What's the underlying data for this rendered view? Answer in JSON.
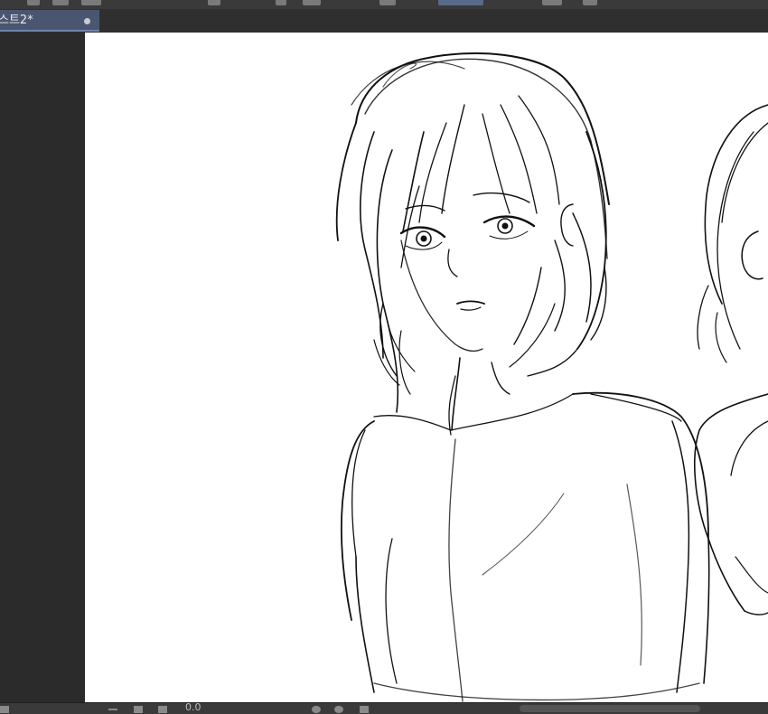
{
  "document_tab": {
    "title": "스트2*"
  },
  "status_bar": {
    "zoom_label": "0.0"
  },
  "colors": {
    "canvas": "#ffffff",
    "workspace": "#2b2b2b",
    "active_tab": "#4a5670",
    "line_art": "#111111"
  },
  "icons": [
    "minus-icon",
    "plus-icon",
    "square-icon",
    "rotate-icon",
    "flip-icon",
    "pen-icon"
  ]
}
